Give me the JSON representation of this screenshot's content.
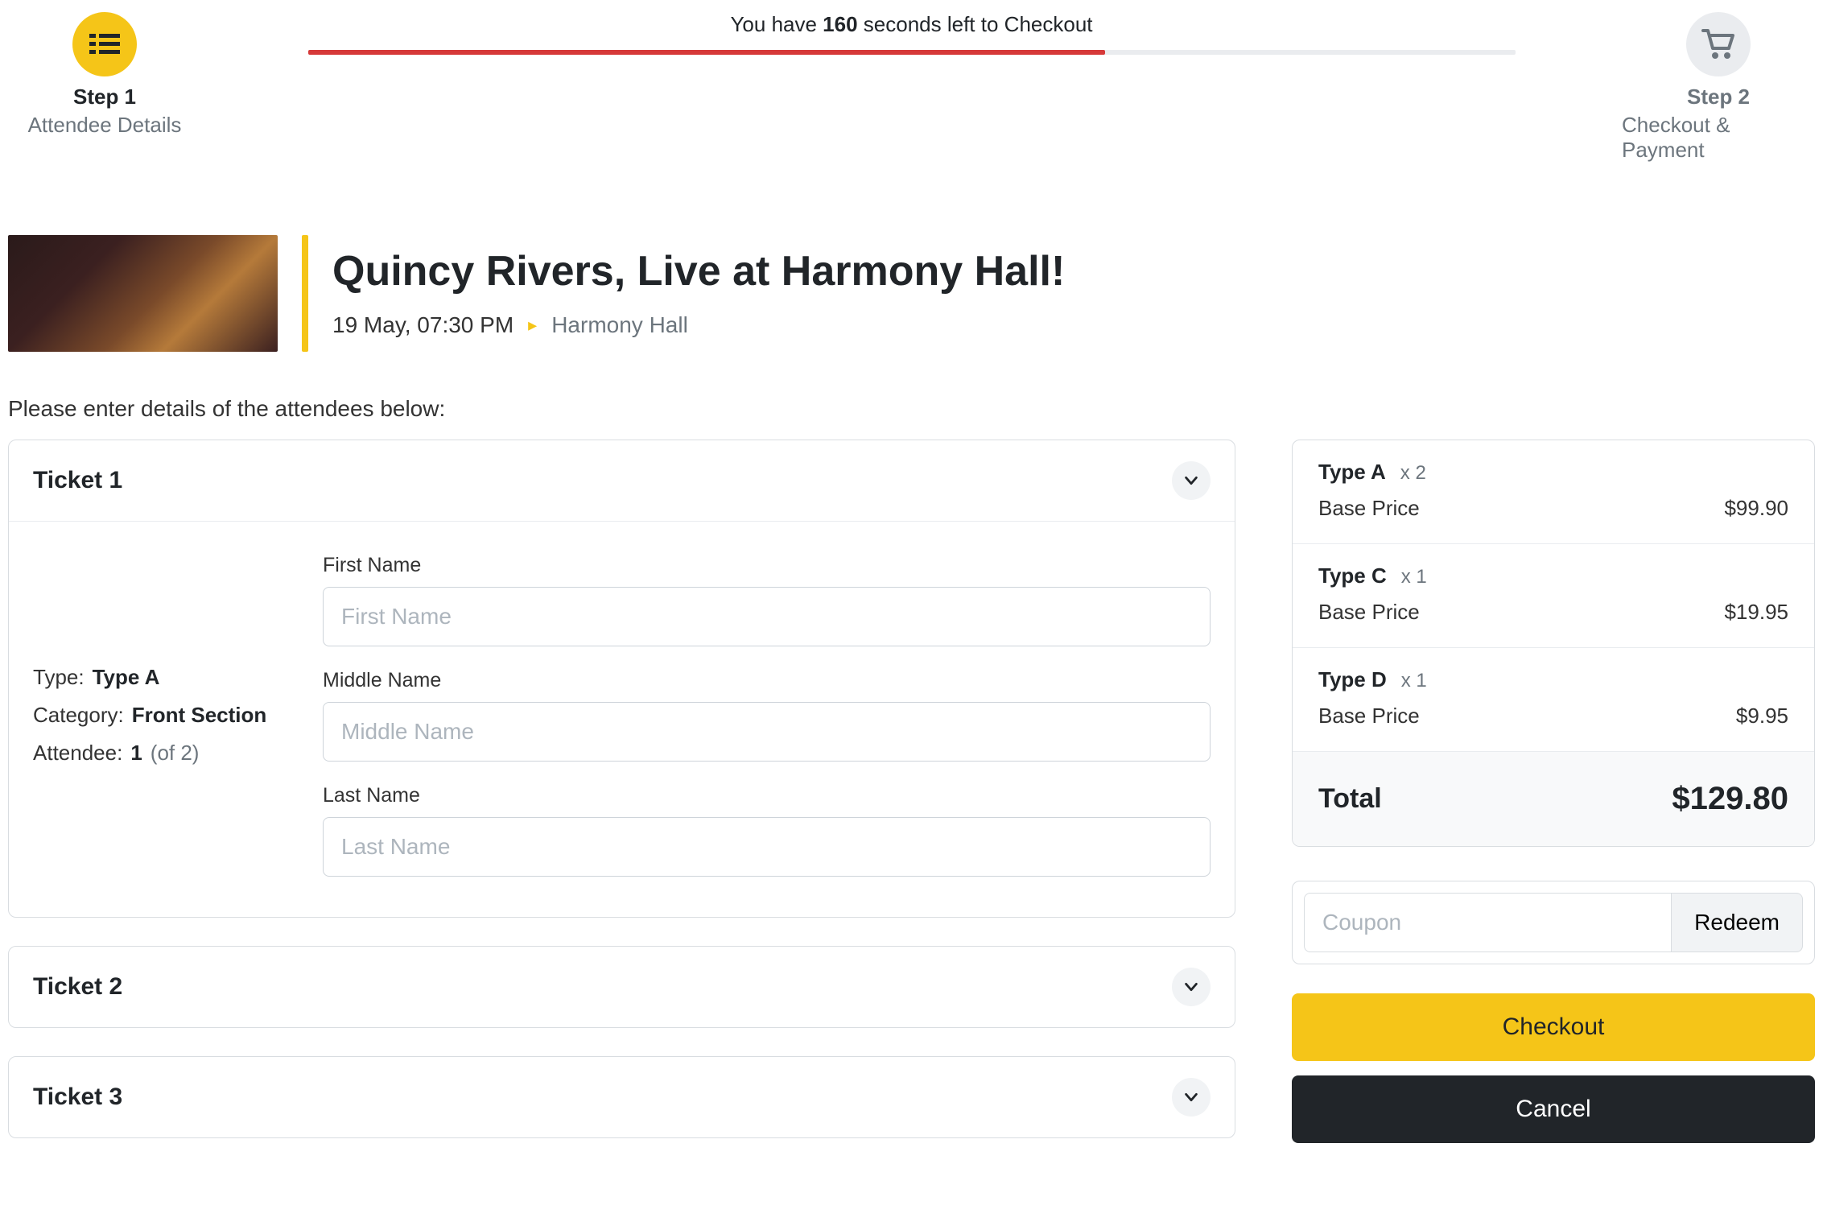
{
  "timer": {
    "prefix": "You have ",
    "seconds": "160",
    "suffix": " seconds left to Checkout",
    "progress_percent": 66
  },
  "steps": {
    "step1": {
      "title": "Step 1",
      "subtitle": "Attendee Details"
    },
    "step2": {
      "title": "Step 2",
      "subtitle": "Checkout & Payment"
    }
  },
  "event": {
    "title": "Quincy Rivers, Live at Harmony Hall!",
    "date": "19 May, 07:30 PM",
    "venue": "Harmony Hall"
  },
  "instruction": "Please enter details of the attendees below:",
  "tickets": [
    {
      "heading": "Ticket 1",
      "expanded": true,
      "meta": {
        "type_label": "Type:",
        "type_value": "Type A",
        "category_label": "Category:",
        "category_value": "Front Section",
        "attendee_label": "Attendee:",
        "attendee_value": "1",
        "attendee_total": "(of 2)"
      },
      "fields": {
        "first_name_label": "First Name",
        "first_name_placeholder": "First Name",
        "middle_name_label": "Middle Name",
        "middle_name_placeholder": "Middle Name",
        "last_name_label": "Last Name",
        "last_name_placeholder": "Last Name"
      }
    },
    {
      "heading": "Ticket 2",
      "expanded": false
    },
    {
      "heading": "Ticket 3",
      "expanded": false
    }
  ],
  "summary": {
    "items": [
      {
        "name": "Type A",
        "qty": "x 2",
        "line_label": "Base Price",
        "amount": "$99.90"
      },
      {
        "name": "Type C",
        "qty": "x 1",
        "line_label": "Base Price",
        "amount": "$19.95"
      },
      {
        "name": "Type D",
        "qty": "x 1",
        "line_label": "Base Price",
        "amount": "$9.95"
      }
    ],
    "total_label": "Total",
    "total_amount": "$129.80"
  },
  "coupon": {
    "placeholder": "Coupon",
    "button": "Redeem"
  },
  "actions": {
    "checkout": "Checkout",
    "cancel": "Cancel"
  }
}
